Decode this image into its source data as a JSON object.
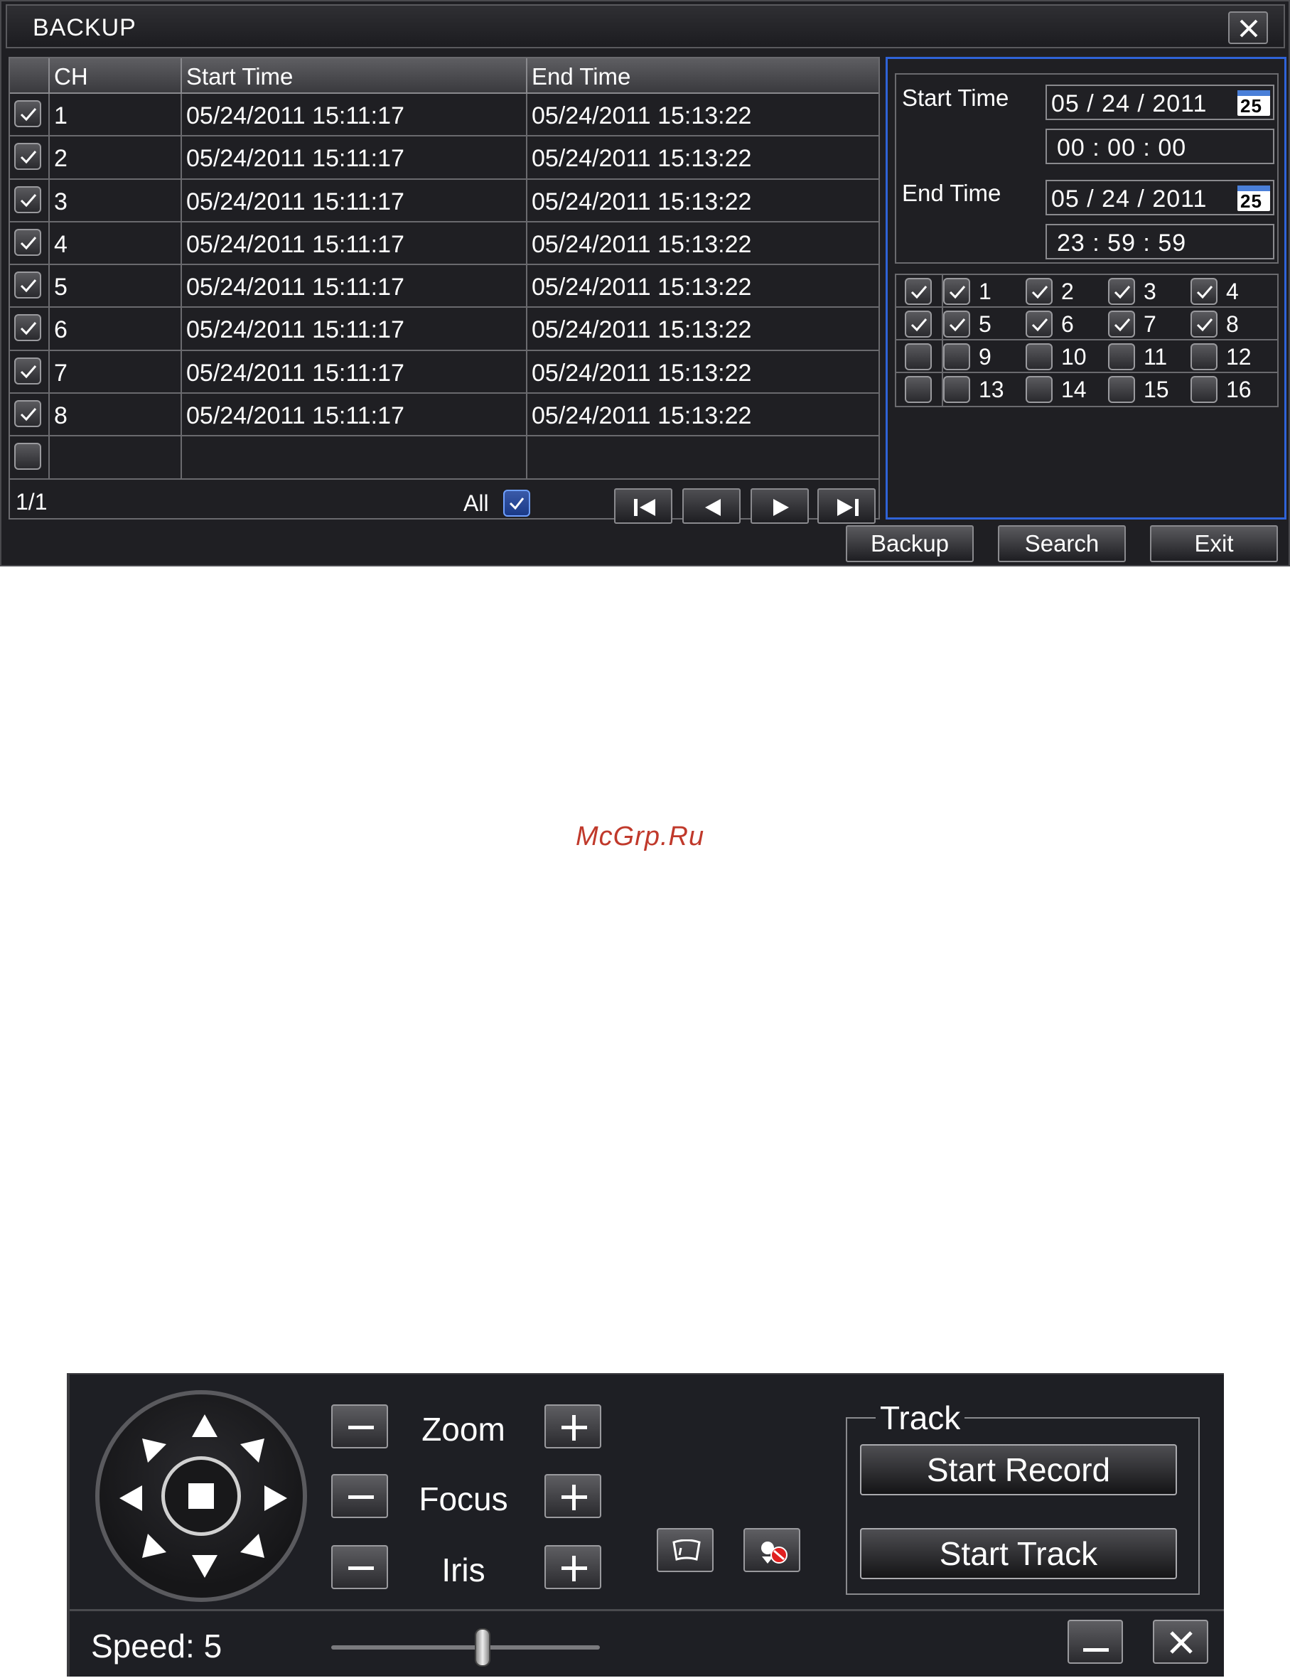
{
  "backup": {
    "title": "BACKUP",
    "columns": [
      "CH",
      "Start Time",
      "End Time"
    ],
    "rows": [
      {
        "checked": true,
        "ch": "1",
        "start": "05/24/2011 15:11:17",
        "end": "05/24/2011 15:13:22"
      },
      {
        "checked": true,
        "ch": "2",
        "start": "05/24/2011 15:11:17",
        "end": "05/24/2011 15:13:22"
      },
      {
        "checked": true,
        "ch": "3",
        "start": "05/24/2011 15:11:17",
        "end": "05/24/2011 15:13:22"
      },
      {
        "checked": true,
        "ch": "4",
        "start": "05/24/2011 15:11:17",
        "end": "05/24/2011 15:13:22"
      },
      {
        "checked": true,
        "ch": "5",
        "start": "05/24/2011 15:11:17",
        "end": "05/24/2011 15:13:22"
      },
      {
        "checked": true,
        "ch": "6",
        "start": "05/24/2011 15:11:17",
        "end": "05/24/2011 15:13:22"
      },
      {
        "checked": true,
        "ch": "7",
        "start": "05/24/2011 15:11:17",
        "end": "05/24/2011 15:13:22"
      },
      {
        "checked": true,
        "ch": "8",
        "start": "05/24/2011 15:11:17",
        "end": "05/24/2011 15:13:22"
      },
      {
        "checked": false,
        "ch": "",
        "start": "",
        "end": ""
      }
    ],
    "page_info": "1/1",
    "all_label": "All",
    "all_checked": true,
    "start_time_label": "Start Time",
    "start_date": "05 / 24 / 2011",
    "start_clock": "00  :  00  :  00",
    "end_time_label": "End Time",
    "end_date": "05 / 24 / 2011",
    "end_clock": "23  :  59  :  59",
    "calendar_number": "25",
    "channel_rows": [
      {
        "all_checked": true,
        "channels": [
          {
            "n": "1",
            "on": true
          },
          {
            "n": "2",
            "on": true
          },
          {
            "n": "3",
            "on": true
          },
          {
            "n": "4",
            "on": true
          }
        ]
      },
      {
        "all_checked": true,
        "channels": [
          {
            "n": "5",
            "on": true
          },
          {
            "n": "6",
            "on": true
          },
          {
            "n": "7",
            "on": true
          },
          {
            "n": "8",
            "on": true
          }
        ]
      },
      {
        "all_checked": false,
        "channels": [
          {
            "n": "9",
            "on": false
          },
          {
            "n": "10",
            "on": false
          },
          {
            "n": "11",
            "on": false
          },
          {
            "n": "12",
            "on": false
          }
        ]
      },
      {
        "all_checked": false,
        "channels": [
          {
            "n": "13",
            "on": false
          },
          {
            "n": "14",
            "on": false
          },
          {
            "n": "15",
            "on": false
          },
          {
            "n": "16",
            "on": false
          }
        ]
      }
    ],
    "buttons": {
      "backup": "Backup",
      "search": "Search",
      "exit": "Exit"
    }
  },
  "watermark": "McGrp.Ru",
  "ptz": {
    "zoom_label": "Zoom",
    "focus_label": "Focus",
    "iris_label": "Iris",
    "track_title": "Track",
    "start_record": "Start Record",
    "start_track": "Start Track",
    "speed_label": "Speed: 5",
    "speed_level": 5
  },
  "colors": {
    "dialog_bg": "#1f1f23",
    "accent_blue": "#2f63d8",
    "watermark": "#c0392b"
  }
}
